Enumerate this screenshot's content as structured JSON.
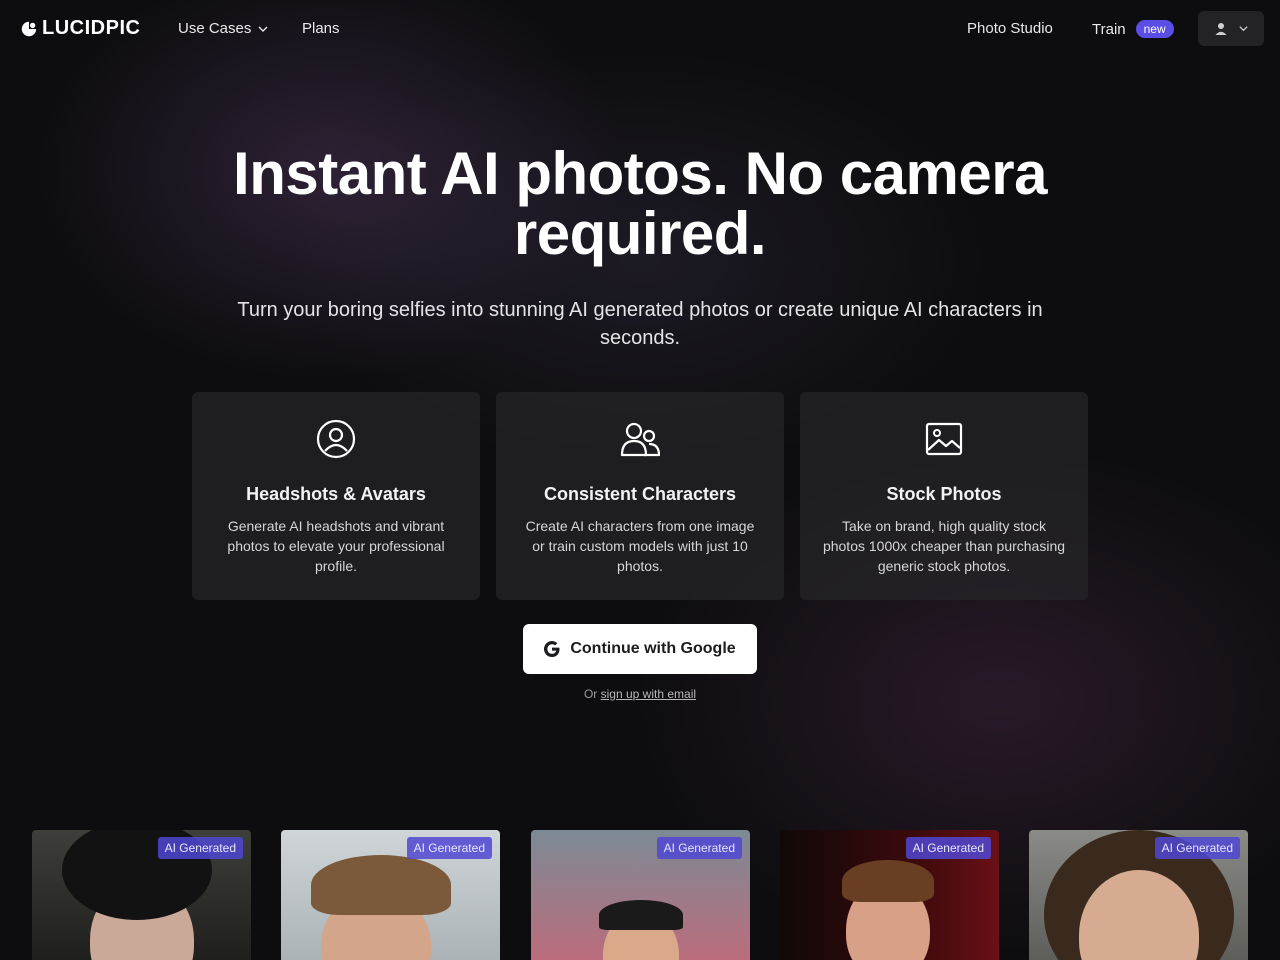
{
  "nav": {
    "logo_text": "LUCIDPIC",
    "use_cases": "Use Cases",
    "plans": "Plans",
    "photo_studio": "Photo Studio",
    "train": "Train",
    "train_badge": "new"
  },
  "hero": {
    "title": "Instant AI photos. No camera required.",
    "subtitle": "Turn your boring selfies into stunning AI generated photos or create unique AI characters in seconds."
  },
  "features": [
    {
      "icon": "user-circle-icon",
      "title": "Headshots & Avatars",
      "description": "Generate AI headshots and vibrant photos to elevate your professional profile."
    },
    {
      "icon": "users-icon",
      "title": "Consistent Characters",
      "description": "Create AI characters from one image or train custom models with just 10 photos."
    },
    {
      "icon": "image-icon",
      "title": "Stock Photos",
      "description": "Take on brand, high quality stock photos 1000x cheaper than purchasing generic stock photos."
    }
  ],
  "cta": {
    "google_label": "Continue with Google",
    "alt_prefix": "Or",
    "alt_link": "sign up with email"
  },
  "gallery": {
    "badge": "AI Generated"
  },
  "colors": {
    "background": "#0d0d0f",
    "accent": "#5b4ee6",
    "card": "#26262a"
  }
}
